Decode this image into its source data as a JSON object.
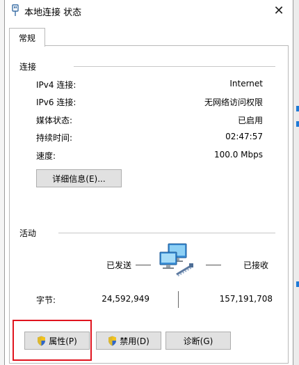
{
  "window": {
    "title": "本地连接 状态",
    "close_glyph": "✕"
  },
  "tabs": [
    {
      "label": "常规"
    }
  ],
  "connection": {
    "section_title": "连接",
    "rows": [
      {
        "label": "IPv4 连接:",
        "value": "Internet"
      },
      {
        "label": "IPv6 连接:",
        "value": "无网络访问权限"
      },
      {
        "label": "媒体状态:",
        "value": "已启用"
      },
      {
        "label": "持续时间:",
        "value": "02:47:57"
      },
      {
        "label": "速度:",
        "value": "100.0 Mbps"
      }
    ],
    "details_button": "详细信息(E)..."
  },
  "activity": {
    "section_title": "活动",
    "sent_label": "已发送",
    "received_label": "已接收",
    "bytes_label": "字节:",
    "bytes_sent": "24,592,949",
    "bytes_received": "157,191,708"
  },
  "buttons": {
    "properties": "属性(P)",
    "disable": "禁用(D)",
    "diagnose": "诊断(G)"
  },
  "icons": {
    "title": "network-adapter-icon",
    "activity": "network-computers-icon",
    "shield": "uac-shield-icon"
  },
  "colors": {
    "highlight": "#e0141e",
    "shield_blue": "#2f66c9",
    "shield_yellow": "#f2c21c",
    "button_face": "#e1e1e1"
  }
}
